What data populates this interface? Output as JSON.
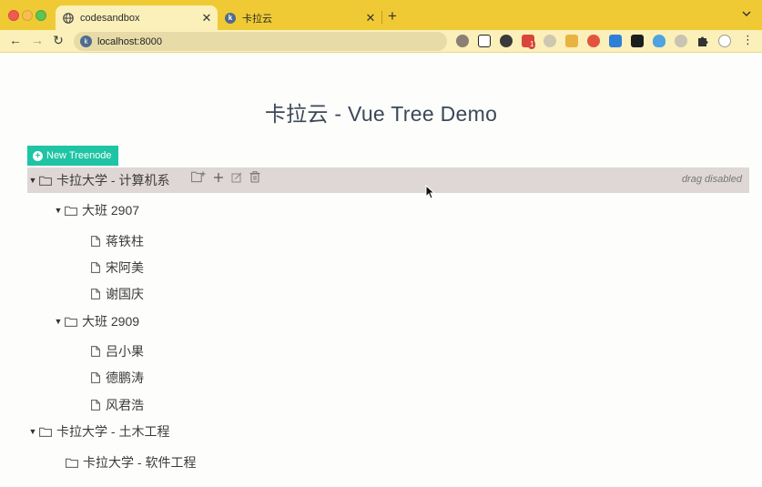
{
  "browser": {
    "tabs": [
      {
        "title": "codesandbox",
        "active": true,
        "favicon": "globe-icon"
      },
      {
        "title": "卡拉云",
        "active": false,
        "favicon": "kalayun-icon"
      }
    ],
    "close_glyph": "✕",
    "new_tab_glyph": "+",
    "tab_menu_glyph": "⌄",
    "address": "localhost:8000",
    "back_glyph": "←",
    "forward_glyph": "→",
    "reload_glyph": "↻",
    "menu_glyph": "⋮",
    "extension_icons": [
      "hedgehog-icon",
      "notion-icon",
      "translate-icon",
      "mail-icon",
      "moon-icon",
      "notes-icon",
      "red-circle-icon",
      "screenshot-icon",
      "dark-icon",
      "shield-icon",
      "chat-icon",
      "puzzle-icon",
      "profile-icon"
    ],
    "mail_badge": "1"
  },
  "page": {
    "title": "卡拉云 - Vue Tree Demo",
    "new_button": "New Treenode",
    "drag_note": "drag disabled"
  },
  "tree": [
    {
      "label": "卡拉大学 - 计算机系",
      "type": "folder",
      "level": 0,
      "expanded": true,
      "hovered": true
    },
    {
      "label": "大班 2907",
      "type": "folder",
      "level": 1,
      "expanded": true
    },
    {
      "label": "蒋铁柱",
      "type": "file",
      "level": 2
    },
    {
      "label": "宋阿美",
      "type": "file",
      "level": 2
    },
    {
      "label": "谢国庆",
      "type": "file",
      "level": 2
    },
    {
      "label": "大班 2909",
      "type": "folder",
      "level": 1,
      "expanded": true
    },
    {
      "label": "吕小果",
      "type": "file",
      "level": 2
    },
    {
      "label": "德鹏涛",
      "type": "file",
      "level": 2
    },
    {
      "label": "风君浩",
      "type": "file",
      "level": 2
    },
    {
      "label": "卡拉大学 - 土木工程",
      "type": "folder",
      "level": 0,
      "expanded": true
    },
    {
      "label": "卡拉大学 - 软件工程",
      "type": "folder",
      "level": 1,
      "expanded": false
    }
  ],
  "colors": {
    "tabbar": "#f0ca35",
    "toolbar": "#fbf0b9",
    "accent": "#1fc4a4",
    "hover_row": "#dfd7d6"
  }
}
